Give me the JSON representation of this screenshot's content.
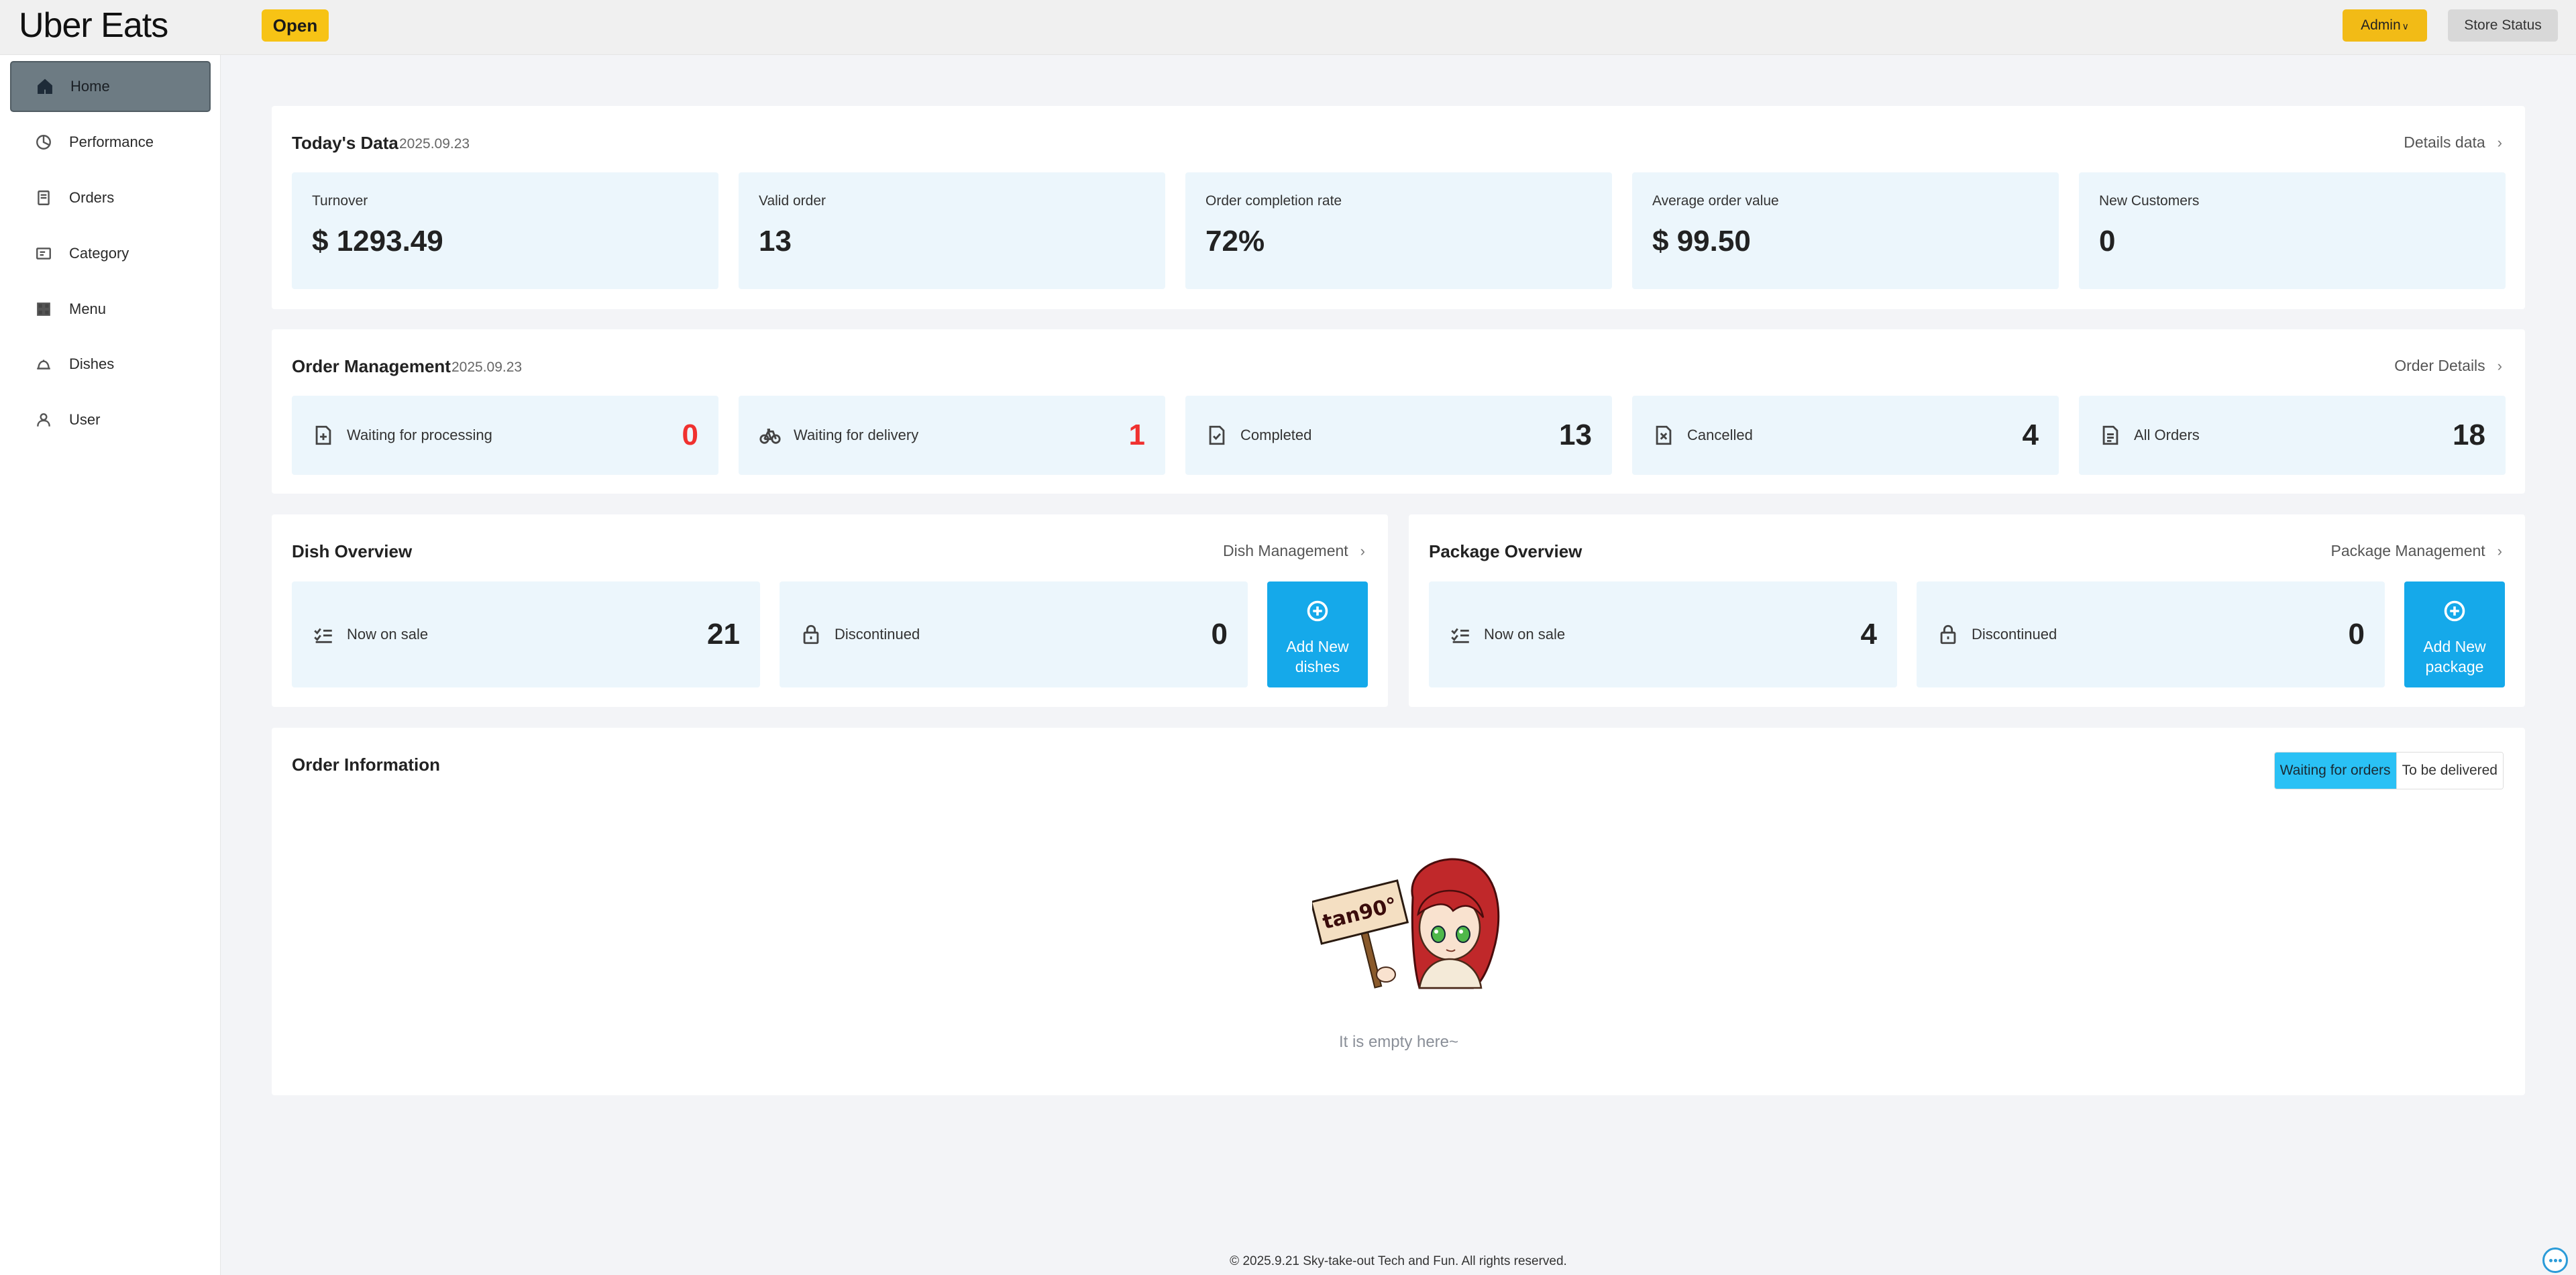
{
  "header": {
    "logo": "Uber Eats",
    "status": "Open",
    "admin": "Admin",
    "store_status": "Store Status"
  },
  "sidebar": {
    "items": [
      {
        "label": "Home",
        "icon": "home-icon",
        "active": true
      },
      {
        "label": "Performance",
        "icon": "pie-chart-icon"
      },
      {
        "label": "Orders",
        "icon": "orders-icon"
      },
      {
        "label": "Category",
        "icon": "category-icon"
      },
      {
        "label": "Menu",
        "icon": "grid-icon"
      },
      {
        "label": "Dishes",
        "icon": "dish-cover-icon"
      },
      {
        "label": "User",
        "icon": "user-icon"
      }
    ]
  },
  "today": {
    "title": "Today's Data",
    "date": "2025.09.23",
    "link": "Details data",
    "cards": [
      {
        "label": "Turnover",
        "value": "$ 1293.49"
      },
      {
        "label": "Valid order",
        "value": "13"
      },
      {
        "label": "Order completion rate",
        "value": "72%"
      },
      {
        "label": "Average order value",
        "value": "$ 99.50"
      },
      {
        "label": "New Customers",
        "value": "0"
      }
    ]
  },
  "orders": {
    "title": "Order Management",
    "date": "2025.09.23",
    "link": "Order Details",
    "stats": [
      {
        "label": "Waiting for processing",
        "value": "0",
        "icon": "add-document-icon"
      },
      {
        "label": "Waiting for delivery",
        "value": "1",
        "icon": "bicycle-icon"
      },
      {
        "label": "Completed",
        "value": "13",
        "icon": "check-document-icon"
      },
      {
        "label": "Cancelled",
        "value": "4",
        "icon": "cancel-document-icon"
      },
      {
        "label": "All Orders",
        "value": "18",
        "icon": "list-document-icon"
      }
    ]
  },
  "dish": {
    "title": "Dish Overview",
    "link": "Dish Management",
    "on_sale_label": "Now on sale",
    "on_sale_value": "21",
    "discontinued_label": "Discontinued",
    "discontinued_value": "0",
    "add_label": "Add New dishes"
  },
  "package": {
    "title": "Package Overview",
    "link": "Package Management",
    "on_sale_label": "Now on sale",
    "on_sale_value": "4",
    "discontinued_label": "Discontinued",
    "discontinued_value": "0",
    "add_label": "Add New package"
  },
  "order_info": {
    "title": "Order Information",
    "tabs": [
      "Waiting for orders",
      "To be delivered"
    ],
    "active_tab": 0,
    "sign_text": "tan90°",
    "empty_text": "It is empty here~"
  },
  "footer": {
    "text": "© 2025.9.21 Sky-take-out Tech and Fun. All rights reserved."
  },
  "colors": {
    "accent_yellow": "#f7c315",
    "primary_blue": "#15a9ea",
    "alert_red": "#f0312f",
    "card_bg": "#ecf6fc"
  }
}
